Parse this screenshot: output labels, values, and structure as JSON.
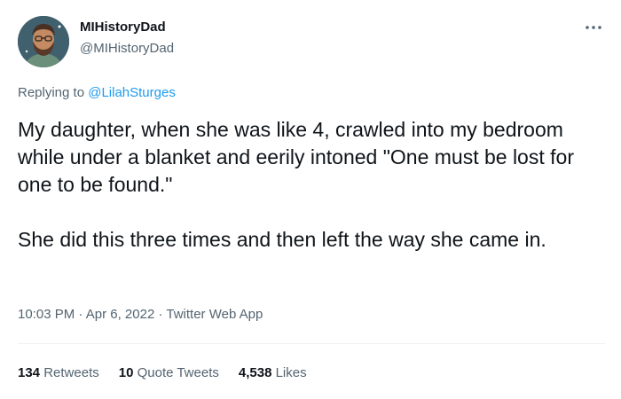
{
  "author": {
    "display_name": "MIHistoryDad",
    "handle": "@MIHistoryDad",
    "avatar_icon": "bearded-man-avatar"
  },
  "reply": {
    "prefix": "Replying to ",
    "to_handle": "@LilahSturges"
  },
  "tweet": {
    "paragraphs": [
      "My daughter, when she was like 4, crawled into my bedroom while under a blanket and eerily intoned \"One must be lost for one to be found.\"",
      "She did this three times and then left the way she came in."
    ]
  },
  "meta": {
    "time": "10:03 PM",
    "date": "Apr 6, 2022",
    "source": "Twitter Web App",
    "separator": "·"
  },
  "stats": {
    "retweets": {
      "count": "134",
      "label": "Retweets"
    },
    "quotes": {
      "count": "10",
      "label": "Quote Tweets"
    },
    "likes": {
      "count": "4,538",
      "label": "Likes"
    }
  },
  "colors": {
    "text": "#0f1419",
    "secondary": "#536471",
    "link": "#1d9bf0",
    "divider": "#eff3f4"
  }
}
